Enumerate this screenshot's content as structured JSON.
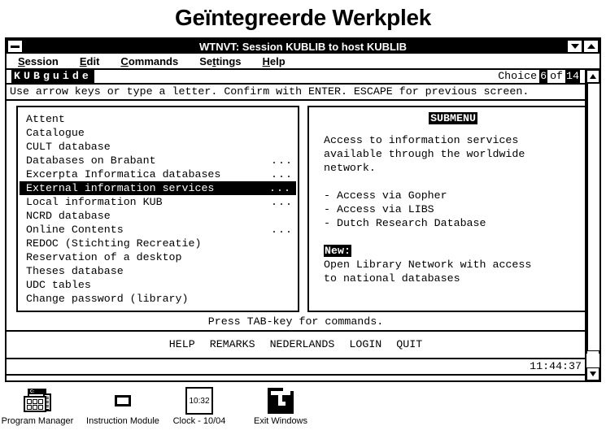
{
  "desktop": {
    "title": "Geïntegreerde Werkplek",
    "icons": [
      {
        "name": "program-manager",
        "label": "Program Manager",
        "icon": "program-manager-icon"
      },
      {
        "name": "instruction-module",
        "label": "Instruction Module",
        "icon": "instruction-module-icon"
      },
      {
        "name": "clock",
        "label": "Clock - 10/04",
        "icon": "clock-icon",
        "face_time": "10:32"
      },
      {
        "name": "exit-windows",
        "label": "Exit Windows",
        "icon": "exit-windows-icon"
      }
    ]
  },
  "window": {
    "title": "WTNVT: Session KUBLIB to host KUBLIB",
    "sysmenu_icon": "minimize-bar-icon",
    "buttons": [
      {
        "name": "minimize-button",
        "icon": "triangle-down-icon"
      },
      {
        "name": "maximize-button",
        "icon": "triangle-up-icon"
      }
    ],
    "menus": [
      {
        "label": "Session",
        "accel": "S"
      },
      {
        "label": "Edit",
        "accel": "E"
      },
      {
        "label": "Commands",
        "accel": "C"
      },
      {
        "label": "Settings",
        "accel": "t"
      },
      {
        "label": "Help",
        "accel": "H"
      }
    ]
  },
  "terminal": {
    "app_name": "KUBguide",
    "choice_label": "Choice",
    "choice_current": "6",
    "choice_of": "of",
    "choice_total": "14",
    "instruction": "Use arrow keys or type a letter. Confirm with ENTER. ESCAPE for previous screen.",
    "menu_items": [
      {
        "label": "Attent",
        "dots": ""
      },
      {
        "label": "Catalogue",
        "dots": ""
      },
      {
        "label": "CULT database",
        "dots": ""
      },
      {
        "label": "Databases on Brabant",
        "dots": "..."
      },
      {
        "label": "Excerpta Informatica databases",
        "dots": "..."
      },
      {
        "label": "External information services",
        "dots": "...",
        "selected": true
      },
      {
        "label": "Local information KUB",
        "dots": "..."
      },
      {
        "label": "NCRD database",
        "dots": ""
      },
      {
        "label": "Online Contents",
        "dots": "..."
      },
      {
        "label": "REDOC (Stichting Recreatie)",
        "dots": ""
      },
      {
        "label": "Reservation of a desktop",
        "dots": ""
      },
      {
        "label": "Theses database",
        "dots": ""
      },
      {
        "label": "UDC tables",
        "dots": ""
      },
      {
        "label": "Change password (library)",
        "dots": ""
      }
    ],
    "detail": {
      "heading": "SUBMENU",
      "paragraph": [
        "Access to information services",
        "available through the worldwide",
        "network."
      ],
      "bullets": [
        "- Access via Gopher",
        "- Access via LIBS",
        "- Dutch Research Database"
      ],
      "new_tag": "New:",
      "new_lines": [
        "Open Library Network with access",
        "to national databases"
      ]
    },
    "tab_hint": "Press TAB-key for commands.",
    "function_keys": [
      "HELP",
      "REMARKS",
      "NEDERLANDS",
      "LOGIN",
      "QUIT"
    ],
    "clock": "11:44:37",
    "scrollbar": {
      "up_icon": "scroll-up-arrow-icon",
      "down_icon": "scroll-down-arrow-icon"
    }
  }
}
